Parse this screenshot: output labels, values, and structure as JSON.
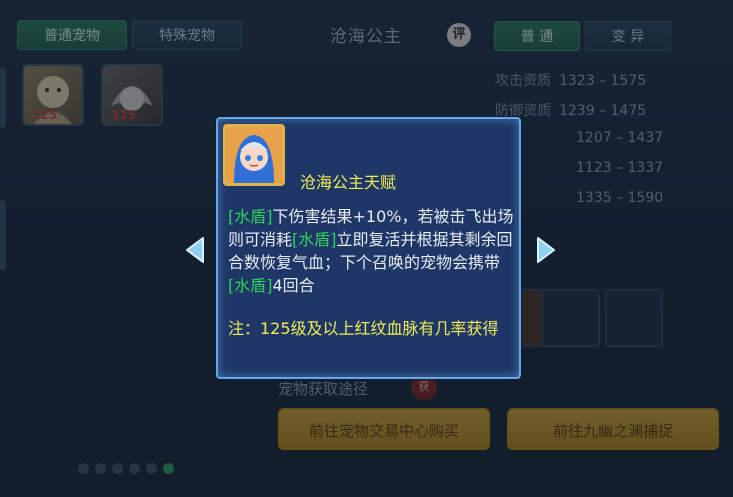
{
  "tabs_left": [
    {
      "label": "普通宠物",
      "active": true
    },
    {
      "label": "特殊宠物",
      "active": false
    }
  ],
  "pet_name": "沧海公主",
  "rate_badge": "评",
  "tabs_right": [
    {
      "label": "普 通",
      "active": true
    },
    {
      "label": "变 异",
      "active": false
    }
  ],
  "pet_thumbs": [
    {
      "level": "125"
    },
    {
      "level": "125"
    }
  ],
  "stats": [
    {
      "label": "攻击资质",
      "value": "1323 – 1575"
    },
    {
      "label": "防御资质",
      "value": "1239 – 1475"
    },
    {
      "label": "",
      "value": "1207 – 1437"
    },
    {
      "label": "",
      "value": "1123 – 1337"
    },
    {
      "label": "",
      "value": "1335 – 1590"
    }
  ],
  "obtain": {
    "label": "宠物获取途径",
    "badge": "获"
  },
  "buttons": {
    "trade": "前往宠物交易中心购买",
    "capture": "前往九幽之渊捕捉"
  },
  "page_dots": {
    "count": 6,
    "active_index": 5
  },
  "popup": {
    "title": "沧海公主天赋",
    "desc_parts": {
      "tag": "[水盾]",
      "p1": "下伤害结果+10%，若被击飞出场则可消耗",
      "p2": "立即复活并根据其剩余回合数恢复气血；下个召唤的宠物会携带",
      "p3": "4回合"
    },
    "note": "注：125级及以上红纹血脉有几率获得"
  },
  "colors": {
    "accent_green": "#2fd05c",
    "note_yellow": "#f2ec55",
    "popup_border": "#6aa6df"
  }
}
